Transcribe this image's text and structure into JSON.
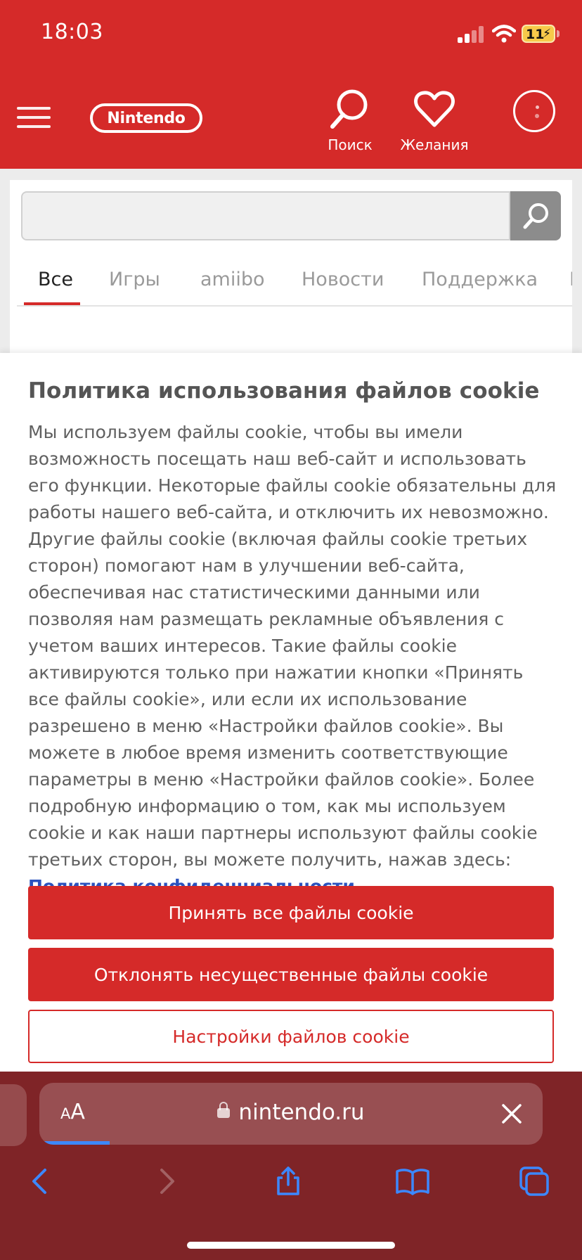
{
  "status_bar": {
    "time": "18:03",
    "battery": "11"
  },
  "header": {
    "logo": "Nintendo",
    "search_label": "Поиск",
    "wishlist_label": "Желания",
    "brand_color": "#d52a29"
  },
  "search": {
    "value": "",
    "placeholder": ""
  },
  "tabs": [
    "Все",
    "Игры",
    "amiibo",
    "Новости",
    "Поддержка",
    "D"
  ],
  "active_tab": "Все",
  "cookie": {
    "title": "Политика использования файлов cookie",
    "body": "Мы используем файлы cookie, чтобы вы имели возможность посещать наш веб-сайт и использовать его функции. Некоторые файлы cookie обязательны для работы нашего веб-сайта, и отключить их невозможно. Другие файлы cookie (включая файлы cookie третьих сторон) помогают нам в улучшении веб-сайта, обеспечивая нас статистическими данными или позволяя нам размещать рекламные объявления с учетом ваших интересов. Такие файлы cookie активируются только при нажатии кнопки «Принять все файлы cookie», или если их использование разрешено в меню «Настройки файлов cookie». Вы можете в любое время изменить соответствующие параметры в меню «Настройки файлов cookie». Более подробную информацию о том, как мы используем cookie и как наши партнеры используют файлы cookie третьих сторон, вы можете получить, нажав здесь:",
    "privacy_link": "Политика конфиденциальности",
    "accept_all": "Принять все файлы cookie",
    "reject_nonessential": "Отклонять несущественные файлы cookie",
    "settings": "Настройки файлов cookie"
  },
  "safari": {
    "aa_small": "A",
    "aa_big": "A",
    "url": "nintendo.ru",
    "load_progress": 0.14,
    "accent_color": "#3c88ff"
  }
}
